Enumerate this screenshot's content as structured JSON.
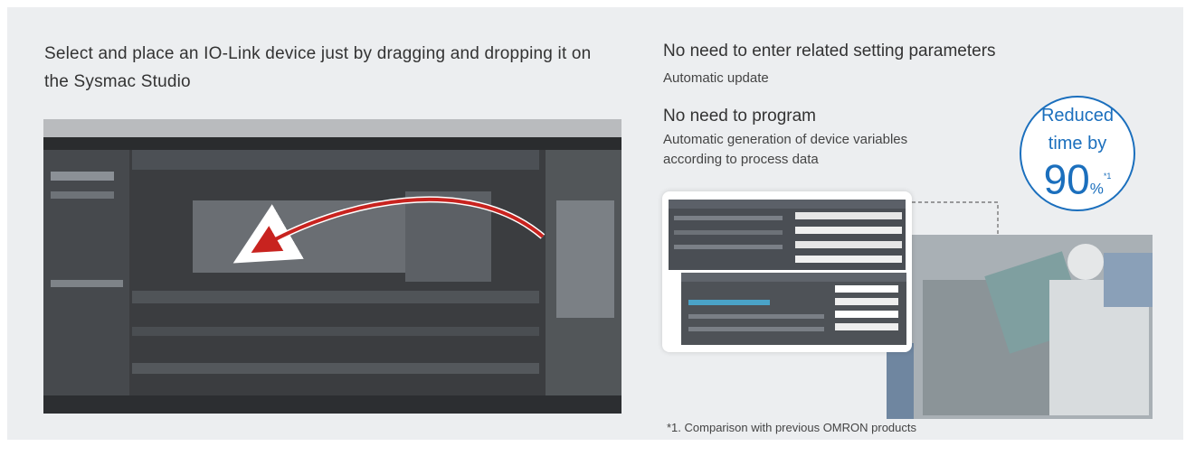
{
  "left": {
    "description": "Select and place an IO-Link device just by dragging and dropping it on the Sysmac Studio"
  },
  "right": {
    "feature1_title": "No need to enter related setting parameters",
    "feature1_sub": "Automatic update",
    "feature2_title": "No need to program",
    "feature2_sub": "Automatic generation of device variables according to process data"
  },
  "badge": {
    "line1": "Reduced",
    "line2": "time by",
    "value": "90",
    "unit": "%",
    "note_ref": "*1"
  },
  "footnote": "*1. Comparison with previous OMRON products",
  "colors": {
    "accent": "#1b6fbd",
    "arrow": "#c8231f",
    "panel": "#eceef0"
  },
  "icons": [
    "drag-arrow-icon"
  ]
}
